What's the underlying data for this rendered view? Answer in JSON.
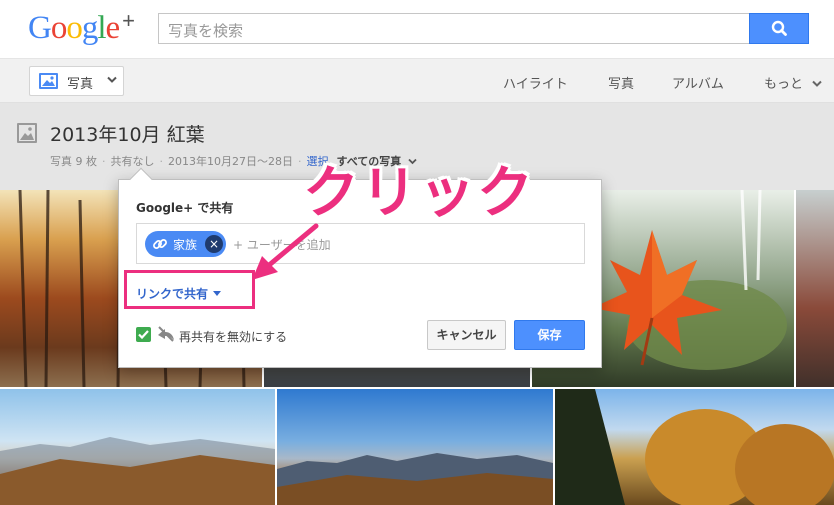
{
  "header": {
    "logo_text": "Google",
    "logo_plus": "+",
    "logo_colors": [
      "#4285f4",
      "#ea4335",
      "#fbbc05",
      "#4285f4",
      "#34a853",
      "#ea4335"
    ],
    "search_placeholder": "写真を検索",
    "search_icon": "magnifier-icon"
  },
  "nav": {
    "photos_button_label": "写真",
    "links": [
      "ハイライト",
      "写真",
      "アルバム",
      "もっと"
    ]
  },
  "album": {
    "title": "2013年10月 紅葉",
    "count": "写真 9 枚",
    "sharing": "共有なし",
    "date_range": "2013年10月27日～28日",
    "select_label": "選択",
    "all_photos_label": "すべての写真"
  },
  "dialog": {
    "title": "Google+ で共有",
    "chip_label": "家族",
    "chip_remove": "×",
    "add_user_placeholder": "+ ユーザーを追加",
    "link_share_label": "リンクで共有",
    "disable_reshare_label": "再共有を無効にする",
    "disable_reshare_checked": true,
    "cancel_label": "キャンセル",
    "save_label": "保存"
  },
  "annotation": {
    "callout_text": "クリック",
    "accent_color": "#ec2f7f"
  }
}
